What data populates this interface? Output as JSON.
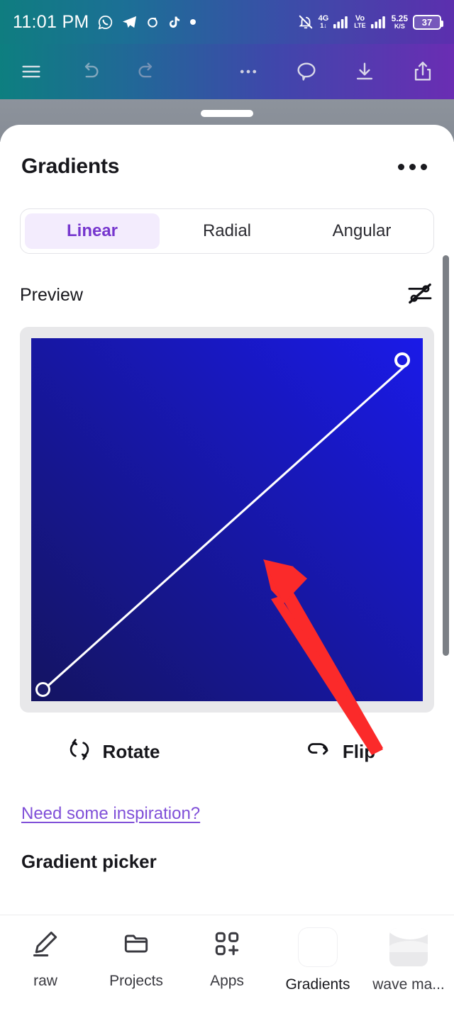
{
  "status_bar": {
    "time": "11:01 PM",
    "left_icons": [
      "whatsapp-icon",
      "telegram-icon",
      "circle-arrow-icon",
      "tiktok-icon",
      "dot-icon"
    ],
    "mute_icon": "bell-off-icon",
    "network_type": "4G",
    "network_sub": "1↓",
    "volte_top": "Vo",
    "volte_bottom": "LTE",
    "data_speed_value": "5.25",
    "data_speed_unit": "K/S",
    "battery_percent": "37"
  },
  "toolbar": {
    "menu_label": "menu-icon",
    "undo_label": "undo-icon",
    "redo_label": "redo-icon",
    "more_label": "more-icon",
    "comment_label": "comment-icon",
    "download_label": "download-icon",
    "share_label": "share-icon"
  },
  "sheet": {
    "title": "Gradients",
    "more_menu": "kebab-menu"
  },
  "tabs": [
    {
      "label": "Linear",
      "active": true
    },
    {
      "label": "Radial",
      "active": false
    },
    {
      "label": "Angular",
      "active": false
    }
  ],
  "preview": {
    "label": "Preview",
    "toggle_handles_icon": "hide-gradient-handles-icon",
    "gradient_start_color": "#141461",
    "gradient_end_color": "#1a1ae8",
    "gradient_angle": "45deg",
    "start_handle": "filled-handle",
    "end_handle": "hollow-handle"
  },
  "actions": [
    {
      "label": "Rotate",
      "icon": "rotate-icon"
    },
    {
      "label": "Flip",
      "icon": "flip-icon"
    }
  ],
  "links": {
    "inspiration": "Need some inspiration?"
  },
  "sections": {
    "gradient_picker_heading": "Gradient picker"
  },
  "annotation": {
    "arrow_color": "#fb2a2a",
    "arrow_direction": "up-left"
  },
  "bottom_nav": [
    {
      "label": "raw",
      "icon": "draw-pen-icon",
      "active": false
    },
    {
      "label": "Projects",
      "icon": "folder-icon",
      "active": false
    },
    {
      "label": "Apps",
      "icon": "apps-grid-plus-icon",
      "active": false
    },
    {
      "label": "Gradients",
      "icon": "color-wheel-icon",
      "active": true
    },
    {
      "label": "wave ma...",
      "icon": "wave-thumbnail-icon",
      "active": false
    }
  ],
  "colors": {
    "accent_purple": "#7636ce",
    "link_purple": "#8050d8",
    "tab_active_bg": "#f3ecfd",
    "annotation_red": "#fb2a2a"
  }
}
